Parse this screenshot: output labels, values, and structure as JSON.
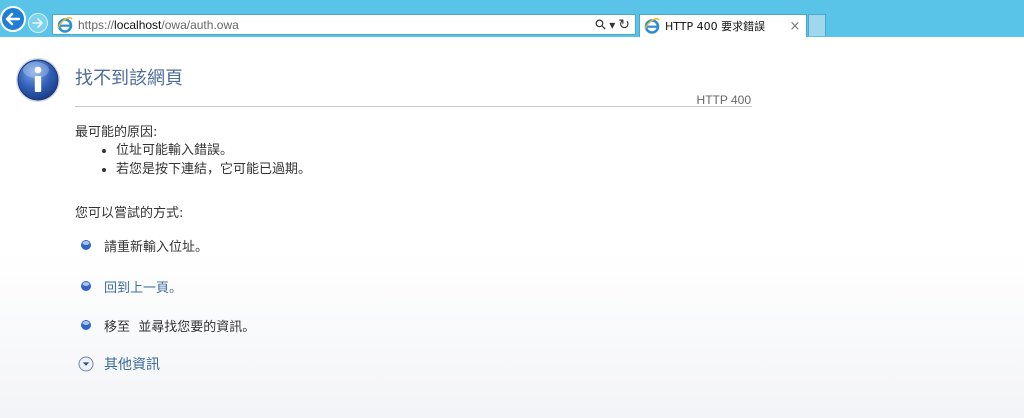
{
  "browser": {
    "url_prefix": "https://",
    "url_host": "localhost",
    "url_path": "/owa/auth.owa",
    "search_glyph": "⚲",
    "dropdown_glyph": "▾",
    "refresh_glyph": "↻",
    "tab_title": "HTTP 400 要求錯誤",
    "tab_close": "×",
    "theme_color": "#59c4e8"
  },
  "page": {
    "title": "找不到該網頁",
    "http_code": "HTTP 400",
    "causes_heading": "最可能的原因:",
    "causes": [
      "位址可能輸入錯誤。",
      "若您是按下連結，它可能已過期。"
    ],
    "try_heading": "您可以嘗試的方式:",
    "options": {
      "retype": "請重新輸入位址。",
      "go_back": "回到上一頁。",
      "search": "移至  並尋找您要的資訊。"
    },
    "more_info": "其他資訊",
    "title_color": "#4e6c9c",
    "link_color": "#3b6b9c",
    "icons": {
      "main": "info-icon",
      "bullet": "blue-bullet-icon",
      "expand": "expand-arrow-icon"
    }
  }
}
